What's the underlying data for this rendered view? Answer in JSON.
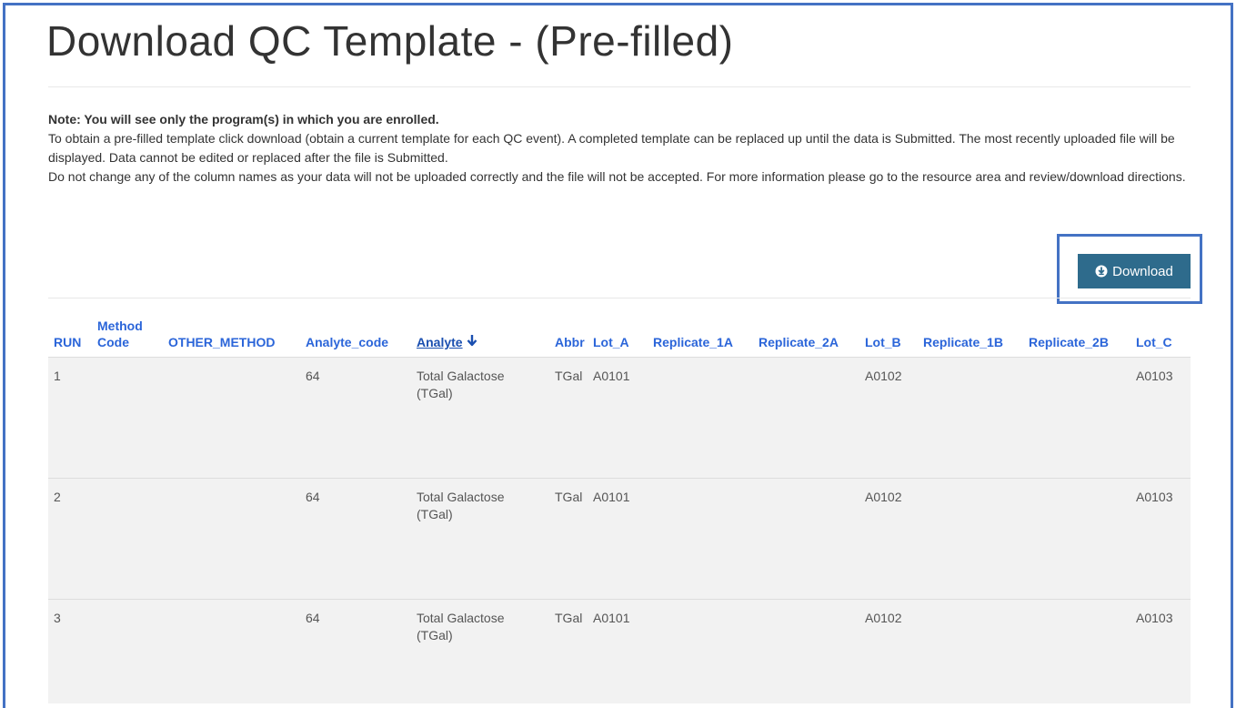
{
  "page": {
    "title": "Download QC Template - (Pre-filled)"
  },
  "note": {
    "heading": "Note: You will see  only the program(s) in which you are enrolled.",
    "paragraph1": "To obtain a pre-filled template click download (obtain a current template for each QC event). A completed template can be replaced up until the data is Submitted. The most recently uploaded file will be displayed. Data cannot be edited or replaced after the file is Submitted.",
    "paragraph2": "Do not change any of the column names as your data will not be uploaded correctly and the file will not be accepted. For more information please go to the resource area and review/download directions."
  },
  "download_button": {
    "label": "Download",
    "icon": "download-circle-icon",
    "color": "#2e6b8c"
  },
  "table": {
    "sorted_column": "Analyte",
    "headers": [
      "RUN",
      "Method Code",
      "OTHER_METHOD",
      "Analyte_code",
      "Analyte",
      "Abbr",
      "Lot_A",
      "Replicate_1A",
      "Replicate_2A",
      "Lot_B",
      "Replicate_1B",
      "Replicate_2B",
      "Lot_C"
    ],
    "rows": [
      [
        "1",
        "",
        "",
        "64",
        "Total Galactose (TGal)",
        "TGal",
        "A0101",
        "",
        "",
        "A0102",
        "",
        "",
        "A0103"
      ],
      [
        "2",
        "",
        "",
        "64",
        "Total Galactose (TGal)",
        "TGal",
        "A0101",
        "",
        "",
        "A0102",
        "",
        "",
        "A0103"
      ],
      [
        "3",
        "",
        "",
        "64",
        "Total Galactose (TGal)",
        "TGal",
        "A0101",
        "",
        "",
        "A0102",
        "",
        "",
        "A0103"
      ]
    ]
  },
  "colors": {
    "header_link": "#2b65d9",
    "highlight_border": "#4472c4",
    "row_background": "#f2f2f2"
  }
}
